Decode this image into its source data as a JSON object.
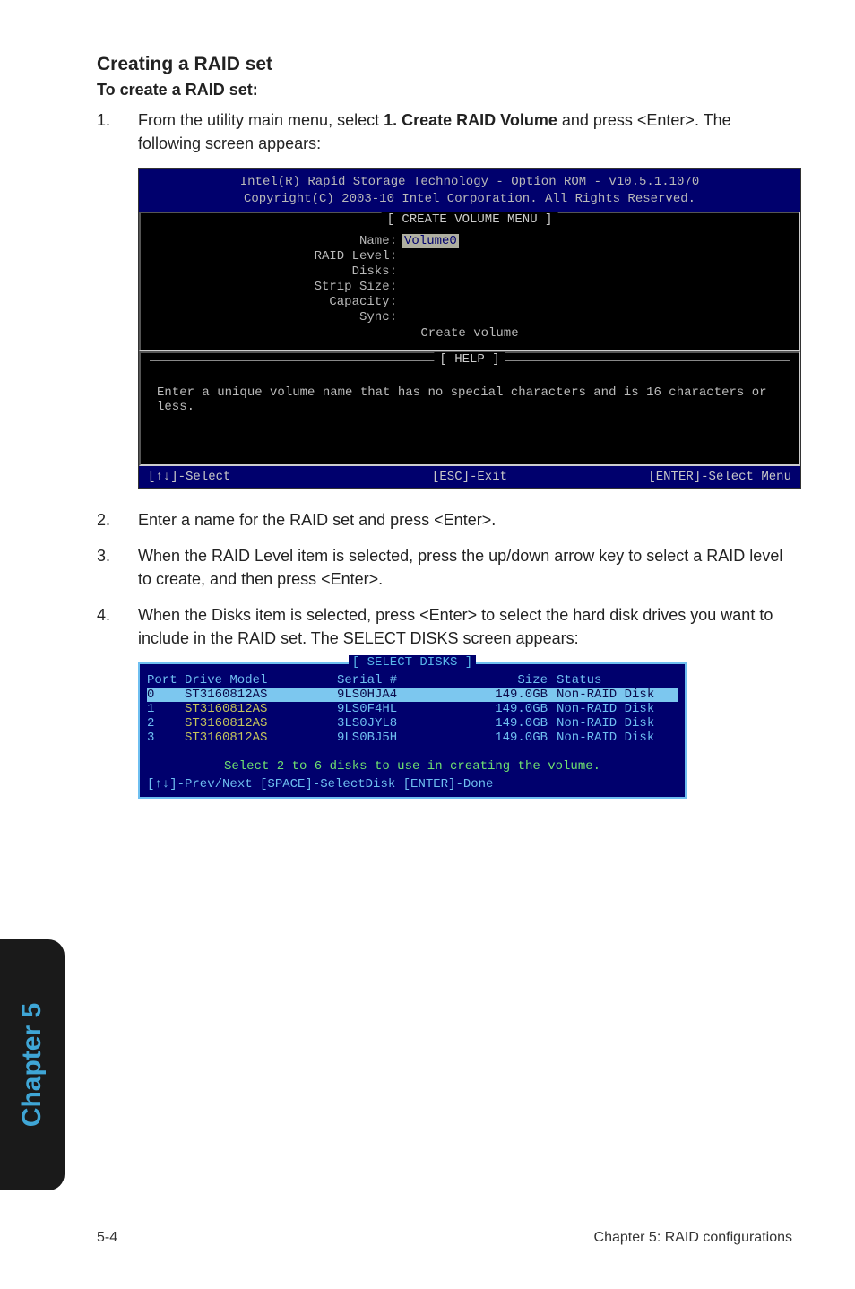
{
  "heading": "Creating a RAID set",
  "subheading": "To create a RAID set:",
  "steps": {
    "1": {
      "num": "1.",
      "text_a": "From the utility main menu, select ",
      "bold": "1. Create RAID Volume",
      "text_b": " and press <Enter>. The following screen appears:"
    },
    "2": {
      "num": "2.",
      "text": "Enter a name for the RAID set and press <Enter>."
    },
    "3": {
      "num": "3.",
      "text": "When the RAID Level item is selected, press the up/down arrow key to select a RAID level to create, and then press <Enter>."
    },
    "4": {
      "num": "4.",
      "text": "When the Disks item is selected, press <Enter> to select the hard disk drives you want to include in the RAID set. The SELECT DISKS screen appears:"
    }
  },
  "bios1": {
    "line1": "Intel(R) Rapid Storage Technology - Option ROM - v10.5.1.1070",
    "line2": "Copyright(C) 2003-10 Intel Corporation.  All Rights Reserved.",
    "create_title": "[ CREATE VOLUME MENU ]",
    "fields": {
      "name_k": "Name:",
      "name_v": "Volume0",
      "raid_k": "RAID Level:",
      "disks_k": "Disks:",
      "strip_k": "Strip Size:",
      "cap_k": "Capacity:",
      "sync_k": "Sync:",
      "create": "Create volume"
    },
    "help_title": "[ HELP ]",
    "help_text": "Enter a unique volume name that has no special characters and is 16 characters or less.",
    "footer": {
      "left": "[↑↓]-Select",
      "mid": "[ESC]-Exit",
      "right": "[ENTER]-Select Menu"
    }
  },
  "bios2": {
    "title": "[ SELECT DISKS ]",
    "headers": {
      "port": "Port",
      "model": "Drive Model",
      "serial": "Serial #",
      "size": "Size",
      "status": "Status"
    },
    "rows": [
      {
        "port": "0",
        "model": "ST3160812AS",
        "serial": "9LS0HJA4",
        "size": "149.0GB",
        "status": "Non-RAID Disk",
        "hl": true
      },
      {
        "port": "1",
        "model": "ST3160812AS",
        "serial": "9LS0F4HL",
        "size": "149.0GB",
        "status": "Non-RAID Disk",
        "hl": false
      },
      {
        "port": "2",
        "model": "ST3160812AS",
        "serial": "3LS0JYL8",
        "size": "149.0GB",
        "status": "Non-RAID Disk",
        "hl": false
      },
      {
        "port": "3",
        "model": "ST3160812AS",
        "serial": "9LS0BJ5H",
        "size": "149.0GB",
        "status": "Non-RAID Disk",
        "hl": false
      }
    ],
    "note": "Select 2 to 6 disks to use in creating the volume.",
    "footer": "[↑↓]-Prev/Next [SPACE]-SelectDisk [ENTER]-Done"
  },
  "sidetab": "Chapter 5",
  "footer": {
    "page": "5-4",
    "title": "Chapter 5: RAID configurations"
  }
}
